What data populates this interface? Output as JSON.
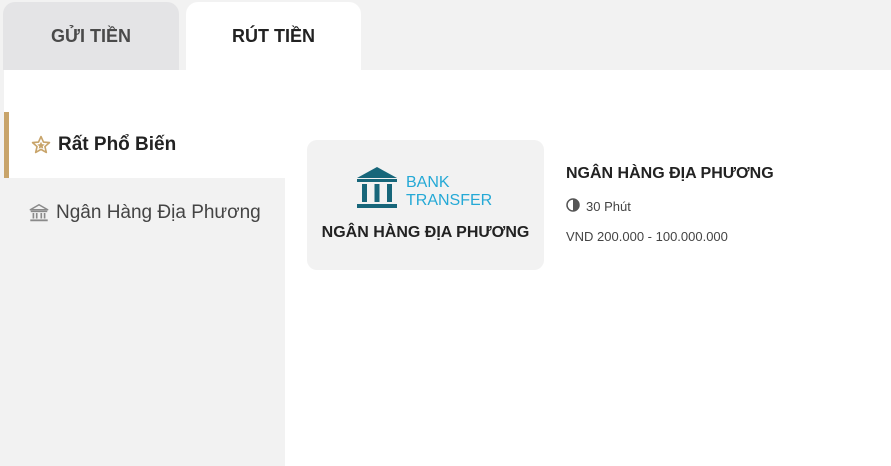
{
  "tabs": {
    "deposit": "GỬI TIỀN",
    "withdraw": "RÚT TIỀN",
    "active": "withdraw"
  },
  "sidebar": {
    "items": [
      {
        "label": "Rất Phổ Biến",
        "icon": "star-icon",
        "active": true
      },
      {
        "label": "Ngân Hàng Địa Phương",
        "icon": "bank-icon",
        "active": false
      }
    ]
  },
  "method": {
    "logo_line1": "BANK",
    "logo_line2": "TRANSFER",
    "card_label": "NGÂN HÀNG ĐỊA PHƯƠNG",
    "title": "NGÂN HÀNG ĐỊA PHƯƠNG",
    "time_icon": "clock-icon",
    "processing_time": "30 Phút",
    "limits": "VND 200.000 - 100.000.000"
  },
  "colors": {
    "accent": "#c8a46a",
    "logo_dark": "#17667a",
    "logo_light": "#25a9d6"
  }
}
